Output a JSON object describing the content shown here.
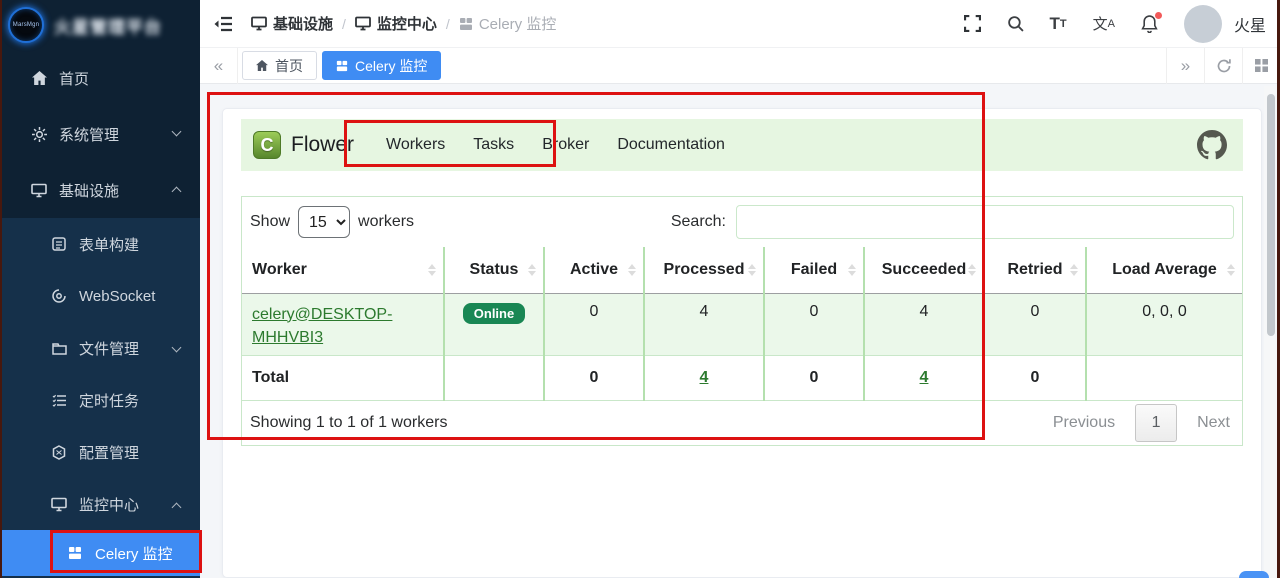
{
  "colors": {
    "accent_blue": "#3f8cf3",
    "sidebar_bg": "#0e2133",
    "flower_navbar_bg": "#e6f6e1",
    "link_green": "#2c7a2e",
    "badge_green": "#198754",
    "annotation_red": "#dd1111"
  },
  "app": {
    "logo_label": "MarsMgn",
    "title": "火星管理平台",
    "username": "火星"
  },
  "header": {
    "breadcrumb": {
      "items": [
        "基础设施",
        "监控中心",
        "Celery 监控"
      ]
    }
  },
  "tabbar": {
    "tabs": [
      {
        "label": "首页"
      },
      {
        "label": "Celery 监控"
      }
    ]
  },
  "sidebar": {
    "items": [
      {
        "label": "首页"
      },
      {
        "label": "系统管理"
      },
      {
        "label": "基础设施"
      },
      {
        "label": "表单构建"
      },
      {
        "label": "WebSocket"
      },
      {
        "label": "文件管理"
      },
      {
        "label": "定时任务"
      },
      {
        "label": "配置管理"
      },
      {
        "label": "监控中心"
      },
      {
        "label": "Celery 监控"
      }
    ]
  },
  "flower": {
    "brand_initial": "C",
    "brand": "Flower",
    "nav": {
      "workers": "Workers",
      "tasks": "Tasks",
      "broker": "Broker",
      "documentation": "Documentation"
    },
    "controls": {
      "show_label": "Show",
      "page_size": "15",
      "show_suffix": "workers",
      "search_label": "Search:",
      "search_value": ""
    },
    "table": {
      "columns": [
        "Worker",
        "Status",
        "Active",
        "Processed",
        "Failed",
        "Succeeded",
        "Retried",
        "Load Average"
      ],
      "rows": [
        {
          "worker": "celery@DESKTOP-MHHVBI3",
          "status": "Online",
          "active": "0",
          "processed": "4",
          "failed": "0",
          "succeeded": "4",
          "retried": "0",
          "load_average": "0, 0, 0"
        }
      ],
      "total": {
        "label": "Total",
        "active": "0",
        "processed": "4",
        "failed": "0",
        "succeeded": "4",
        "retried": "0"
      }
    },
    "footer": {
      "showing": "Showing 1 to 1 of 1 workers",
      "pagination": {
        "previous": "Previous",
        "page": "1",
        "next": "Next"
      }
    }
  }
}
